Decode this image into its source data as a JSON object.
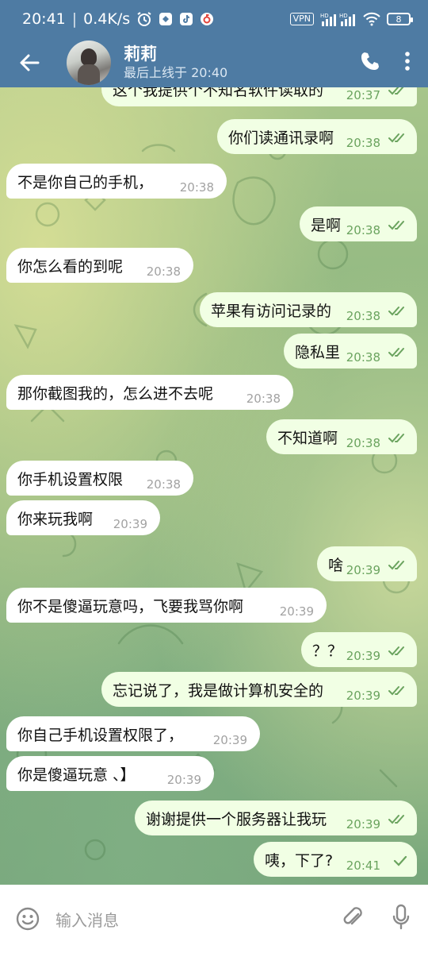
{
  "status_bar": {
    "time": "20:41",
    "net_speed": "0.4K/s",
    "vpn": "VPN",
    "battery": "8",
    "icons": [
      "alarm-icon",
      "app-icon",
      "tiktok-icon",
      "netease-music-icon",
      "signal-icon",
      "wifi-icon"
    ]
  },
  "header": {
    "name": "莉莉",
    "last_seen": "最后上线于 20:40",
    "icons": [
      "back-arrow-icon",
      "phone-icon",
      "more-vert-icon"
    ]
  },
  "messages": [
    {
      "dir": "out",
      "text": "这个我提供个不知名软件读取的",
      "time": "20:37",
      "read": true
    },
    {
      "dir": "out",
      "text": "你们读通讯录啊",
      "time": "20:38",
      "read": true
    },
    {
      "dir": "in",
      "text": "不是你自己的手机，",
      "time": "20:38"
    },
    {
      "dir": "out",
      "text": "是啊",
      "time": "20:38",
      "read": true
    },
    {
      "dir": "in",
      "text": "你怎么看的到呢",
      "time": "20:38"
    },
    {
      "dir": "out",
      "text": "苹果有访问记录的",
      "time": "20:38",
      "read": true
    },
    {
      "dir": "out",
      "text": "隐私里",
      "time": "20:38",
      "read": true
    },
    {
      "dir": "in",
      "text": "那你截图我的，怎么进不去呢",
      "time": "20:38"
    },
    {
      "dir": "out",
      "text": "不知道啊",
      "time": "20:38",
      "read": true
    },
    {
      "dir": "in",
      "text": "你手机设置权限",
      "time": "20:38"
    },
    {
      "dir": "in",
      "text": "你来玩我啊",
      "time": "20:39"
    },
    {
      "dir": "out",
      "text": "啥",
      "time": "20:39",
      "read": true
    },
    {
      "dir": "in",
      "text": "你不是傻逼玩意吗，飞要我骂你啊",
      "time": "20:39"
    },
    {
      "dir": "out",
      "text": "？？",
      "time": "20:39",
      "read": true
    },
    {
      "dir": "out",
      "text": "忘记说了，我是做计算机安全的",
      "time": "20:39",
      "read": true
    },
    {
      "dir": "in",
      "text": "你自己手机设置权限了，",
      "time": "20:39"
    },
    {
      "dir": "in",
      "text": "你是傻逼玩意 、】",
      "time": "20:39"
    },
    {
      "dir": "out",
      "text": "谢谢提供一个服务器让我玩",
      "time": "20:39",
      "read": true
    },
    {
      "dir": "out",
      "text": "咦，下了?",
      "time": "20:41",
      "read": false
    }
  ],
  "input": {
    "placeholder": "输入消息",
    "icons": [
      "emoji-icon",
      "attach-icon",
      "mic-icon"
    ]
  },
  "colors": {
    "header_bg": "#4e7ba3",
    "bubble_out": "#f1ffe4",
    "bubble_in": "#ffffff",
    "check_green": "#6aa35e"
  }
}
